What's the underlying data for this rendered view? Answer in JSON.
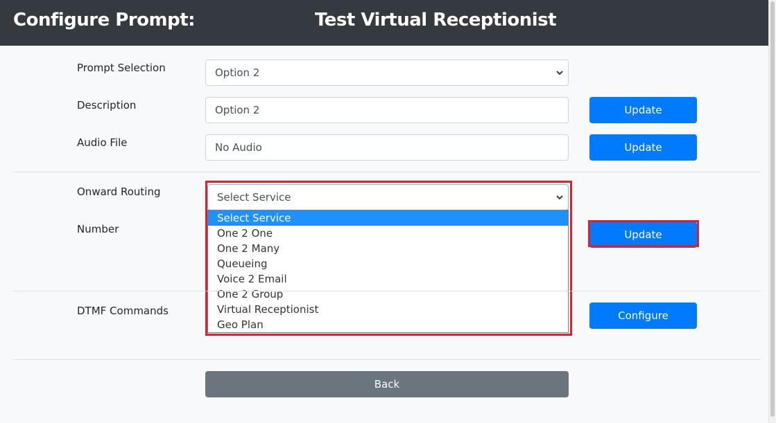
{
  "header": {
    "label": "Configure Prompt:",
    "name": "Test Virtual Receptionist"
  },
  "form": {
    "prompt_selection": {
      "label": "Prompt Selection",
      "value": "Option 2"
    },
    "description": {
      "label": "Description",
      "value": "Option 2",
      "button": "Update"
    },
    "audio_file": {
      "label": "Audio File",
      "value": "No Audio",
      "button": "Update"
    },
    "onward_routing": {
      "label": "Onward Routing",
      "value": "Select Service",
      "options": [
        "Select Service",
        "One 2 One",
        "One 2 Many",
        "Queueing",
        "Voice 2 Email",
        "One 2 Group",
        "Virtual Receptionist",
        "Geo Plan"
      ]
    },
    "number": {
      "label": "Number",
      "button": "Update"
    },
    "dtmf": {
      "label": "DTMF Commands",
      "button": "Configure"
    },
    "back_button": "Back"
  },
  "colors": {
    "header_bg": "#343a40",
    "primary": "#007bff",
    "secondary": "#6c757d",
    "highlight": "#e0202a",
    "selected_option": "#1e90ff"
  }
}
